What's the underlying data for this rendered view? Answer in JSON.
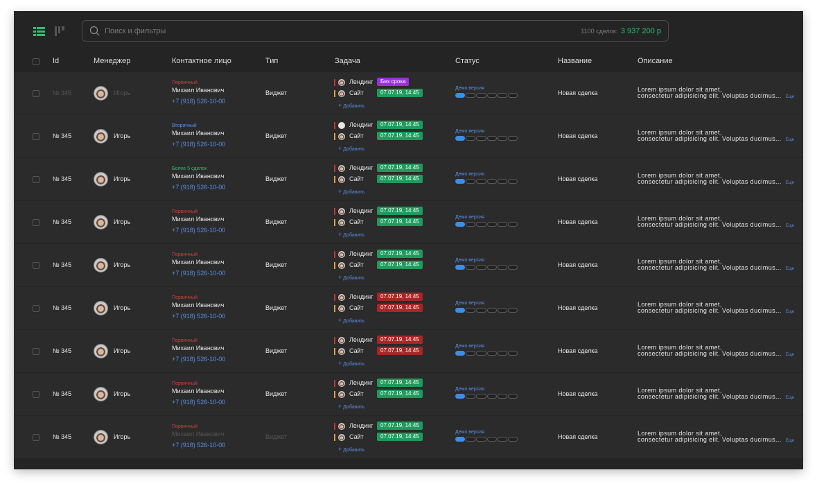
{
  "search": {
    "placeholder": "Поиск и фильтры",
    "count_label": "1100 сделок:",
    "sum": "3 937 200 р"
  },
  "colors": {
    "accent_blue": "#5b8fe8",
    "sum_green": "#2fbf71",
    "badge_green": "#1f9a5c",
    "badge_red": "#a82525",
    "badge_purple": "#9b2ee0",
    "tag_red": "#d93b3b"
  },
  "icons": [
    "list-view-icon",
    "kanban-view-icon",
    "search-icon",
    "avatar",
    "plus-icon"
  ],
  "columns": {
    "id": "Id",
    "manager": "Менеджер",
    "contact": "Контактное лицо",
    "type": "Тип",
    "task": "Задача",
    "status": "Статус",
    "name": "Название",
    "description": "Описание"
  },
  "add_label": "Добавить",
  "status_label": "Демо версия",
  "status_steps": 6,
  "status_done": 1,
  "more_label": "Еще",
  "rows": [
    {
      "id": "№ 345",
      "manager": "Игорь",
      "contact_tag": "Первичный",
      "contact_tag_color": "red",
      "contact_name": "Михаил Иванович",
      "phone": "+7 (918) 526-10-00",
      "type": "Виджет",
      "deal": "Новая сделка",
      "description": "Lorem ipsum dolor sit amet, consectetur adipisicing elit. Voluptas ducimus...",
      "dim": [
        "id",
        "manager"
      ],
      "tasks": [
        {
          "label": "Лендинг",
          "badge": "Без срока",
          "color": "purple",
          "bar": "red"
        },
        {
          "label": "Сайт",
          "badge": "07.07.19, 14:45",
          "color": "green",
          "bar": "orange"
        }
      ]
    },
    {
      "id": "№ 345",
      "manager": "Игорь",
      "contact_tag": "Вторичный",
      "contact_tag_color": "blue",
      "contact_name": "Михаил Иванович",
      "phone": "+7 (918) 526-10-00",
      "type": "Виджет",
      "deal": "Новая сделка",
      "description": "Lorem ipsum dolor sit amet, consectetur adipisicing elit. Voluptas ducimus...",
      "dim": [],
      "tasks": [
        {
          "label": "Лендинг",
          "badge": "07.07.19, 14:45",
          "color": "green",
          "bar": "red",
          "blank": true
        },
        {
          "label": "Сайт",
          "badge": "07.07.19, 14:45",
          "color": "green",
          "bar": "orange"
        }
      ]
    },
    {
      "id": "№ 345",
      "manager": "Игорь",
      "contact_tag": "Более 5 сделок",
      "contact_tag_color": "green",
      "contact_name": "Михаил Иванович",
      "phone": "+7 (918) 526-10-00",
      "type": "Виджет",
      "deal": "Новая сделка",
      "description": "Lorem ipsum dolor sit amet, consectetur adipisicing elit. Voluptas ducimus...",
      "dim": [],
      "tasks": [
        {
          "label": "Лендинг",
          "badge": "07.07.19, 14:45",
          "color": "green",
          "bar": "red"
        },
        {
          "label": "Сайт",
          "badge": "07.07.19, 14:45",
          "color": "green",
          "bar": "orange"
        }
      ]
    },
    {
      "id": "№ 345",
      "manager": "Игорь",
      "contact_tag": "Первичный",
      "contact_tag_color": "red",
      "contact_name": "Михаил Иванович",
      "phone": "+7 (918) 526-10-00",
      "type": "Виджет",
      "deal": "Новая сделка",
      "description": "Lorem ipsum dolor sit amet, consectetur adipisicing elit. Voluptas ducimus...",
      "dim": [],
      "tasks": [
        {
          "label": "Лендинг",
          "badge": "07.07.19, 14:45",
          "color": "green",
          "bar": "red"
        },
        {
          "label": "Сайт",
          "badge": "07.07.19, 14:45",
          "color": "green",
          "bar": "orange"
        }
      ]
    },
    {
      "id": "№ 345",
      "manager": "Игорь",
      "contact_tag": "Первичный",
      "contact_tag_color": "red",
      "contact_name": "Михаил Иванович",
      "phone": "+7 (918) 526-10-00",
      "type": "Виджет",
      "deal": "Новая сделка",
      "description": "Lorem ipsum dolor sit amet, consectetur adipisicing elit. Voluptas ducimus...",
      "dim": [],
      "tasks": [
        {
          "label": "Лендинг",
          "badge": "07.07.19, 14:45",
          "color": "green",
          "bar": "red"
        },
        {
          "label": "Сайт",
          "badge": "07.07.19, 14:45",
          "color": "green",
          "bar": "orange"
        }
      ]
    },
    {
      "id": "№ 345",
      "manager": "Игорь",
      "contact_tag": "Первичный",
      "contact_tag_color": "red",
      "contact_name": "Михаил Иванович",
      "phone": "+7 (918) 526-10-00",
      "type": "Виджет",
      "deal": "Новая сделка",
      "description": "Lorem ipsum dolor sit amet, consectetur adipisicing elit. Voluptas ducimus...",
      "dim": [],
      "tasks": [
        {
          "label": "Лендинг",
          "badge": "07.07.19, 14:45",
          "color": "redb",
          "bar": "red"
        },
        {
          "label": "Сайт",
          "badge": "07.07.19, 14:45",
          "color": "redb",
          "bar": "orange"
        }
      ]
    },
    {
      "id": "№ 345",
      "manager": "Игорь",
      "contact_tag": "Первичный",
      "contact_tag_color": "red",
      "contact_name": "Михаил Иванович",
      "phone": "+7 (918) 526-10-00",
      "type": "Виджет",
      "deal": "Новая сделка",
      "description": "Lorem ipsum dolor sit amet, consectetur adipisicing elit. Voluptas ducimus...",
      "dim": [],
      "tasks": [
        {
          "label": "Лендинг",
          "badge": "07.07.19, 14:45",
          "color": "redb",
          "bar": "red"
        },
        {
          "label": "Сайт",
          "badge": "07.07.19, 14:45",
          "color": "redb",
          "bar": "orange"
        }
      ]
    },
    {
      "id": "№ 345",
      "manager": "Игорь",
      "contact_tag": "Первичный",
      "contact_tag_color": "red",
      "contact_name": "Михаил Иванович",
      "phone": "+7 (918) 526-10-00",
      "type": "Виджет",
      "deal": "Новая сделка",
      "description": "Lorem ipsum dolor sit amet, consectetur adipisicing elit. Voluptas ducimus...",
      "dim": [],
      "tasks": [
        {
          "label": "Лендинг",
          "badge": "07.07.19, 14:45",
          "color": "green",
          "bar": "red"
        },
        {
          "label": "Сайт",
          "badge": "07.07.19, 14:45",
          "color": "green",
          "bar": "orange"
        }
      ]
    },
    {
      "id": "№ 345",
      "manager": "Игорь",
      "contact_tag": "Первичный",
      "contact_tag_color": "red",
      "contact_name": "Михаил Иванович",
      "phone": "+7 (918) 526-10-00",
      "type": "Виджет",
      "deal": "Новая сделка",
      "description": "Lorem ipsum dolor sit amet, consectetur adipisicing elit. Voluptas ducimus...",
      "dim": [
        "contact_name",
        "type"
      ],
      "tasks": [
        {
          "label": "Лендинг",
          "badge": "07.07.19, 14:45",
          "color": "green",
          "bar": "red"
        },
        {
          "label": "Сайт",
          "badge": "07.07.19, 14:45",
          "color": "green",
          "bar": "orange"
        }
      ]
    }
  ]
}
